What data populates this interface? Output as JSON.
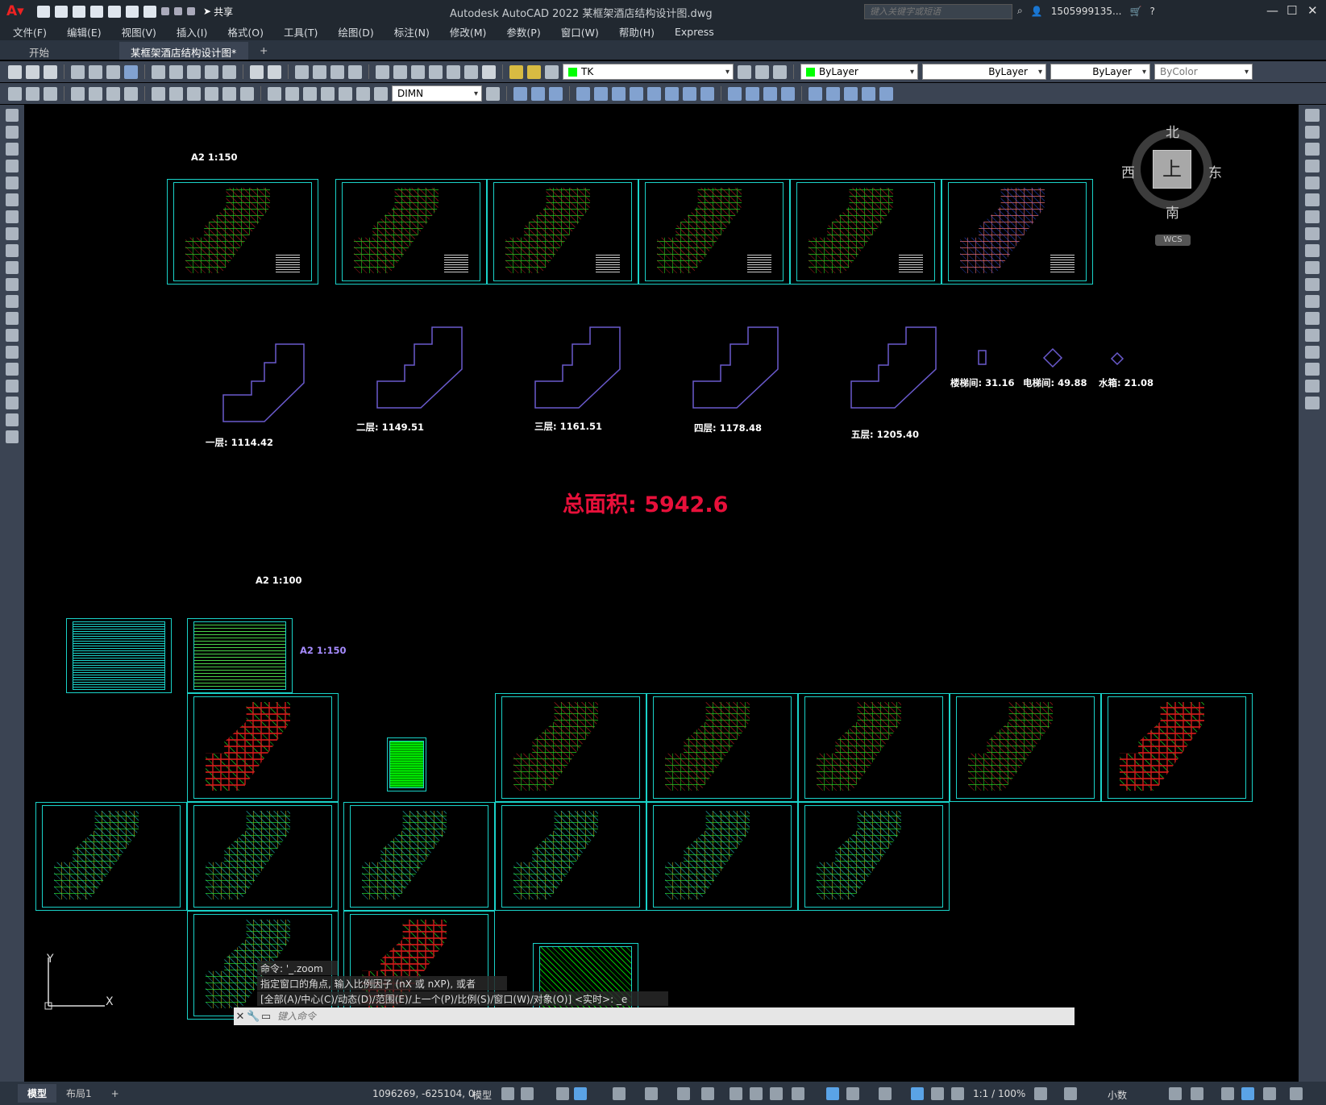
{
  "window": {
    "title": "Autodesk AutoCAD 2022    某框架酒店结构设计图.dwg",
    "share_label": "共享",
    "search_placeholder": "键入关键字或短语",
    "user": "1505999135...",
    "min": "—",
    "max": "☐",
    "close": "✕"
  },
  "menu": [
    "文件(F)",
    "编辑(E)",
    "视图(V)",
    "插入(I)",
    "格式(O)",
    "工具(T)",
    "绘图(D)",
    "标注(N)",
    "修改(M)",
    "参数(P)",
    "窗口(W)",
    "帮助(H)",
    "Express"
  ],
  "tabs": {
    "start": "开始",
    "doc": "某框架酒店结构设计图*",
    "close": "✕",
    "add": "+"
  },
  "toolbar": {
    "layer": "TK",
    "color": "ByLayer",
    "linetype": "ByLayer",
    "lineweight": "ByLayer",
    "plotstyle": "ByColor",
    "dimstyle": "DIMN"
  },
  "drawing": {
    "scale_a2_150": "A2 1:150",
    "scale_a2_100": "A2 1:100",
    "scale_a2_150_b": "A2 1:150",
    "areas": [
      "一层: 1114.42",
      "二层: 1149.51",
      "三层: 1161.51",
      "四层: 1178.48",
      "五层: 1205.40",
      "楼梯间: 31.16",
      "电梯间: 49.88",
      "水箱: 21.08"
    ],
    "total": "总面积: 5942.6"
  },
  "viewcube": {
    "north": "北",
    "south": "南",
    "east": "东",
    "west": "西",
    "top": "上",
    "wcs": "WCS"
  },
  "command": {
    "history": [
      "命令: '_.zoom",
      "指定窗口的角点, 输入比例因子 (nX 或 nXP), 或者",
      "[全部(A)/中心(C)/动态(D)/范围(E)/上一个(P)/比例(S)/窗口(W)/对象(O)] <实时>: _e"
    ],
    "placeholder": "键入命令"
  },
  "ucs": {
    "y": "Y",
    "x": "X"
  },
  "status": {
    "tab_model": "模型",
    "tab_layout": "布局1",
    "add": "+",
    "coords": "1096269, -625104, 0",
    "model": "模型",
    "scale": "1:1 / 100%",
    "units": "小数"
  },
  "colors": {
    "background": "#000000",
    "frame": "#1ad2c8",
    "total_text": "#e8103a",
    "outline": "#6a5acd"
  }
}
